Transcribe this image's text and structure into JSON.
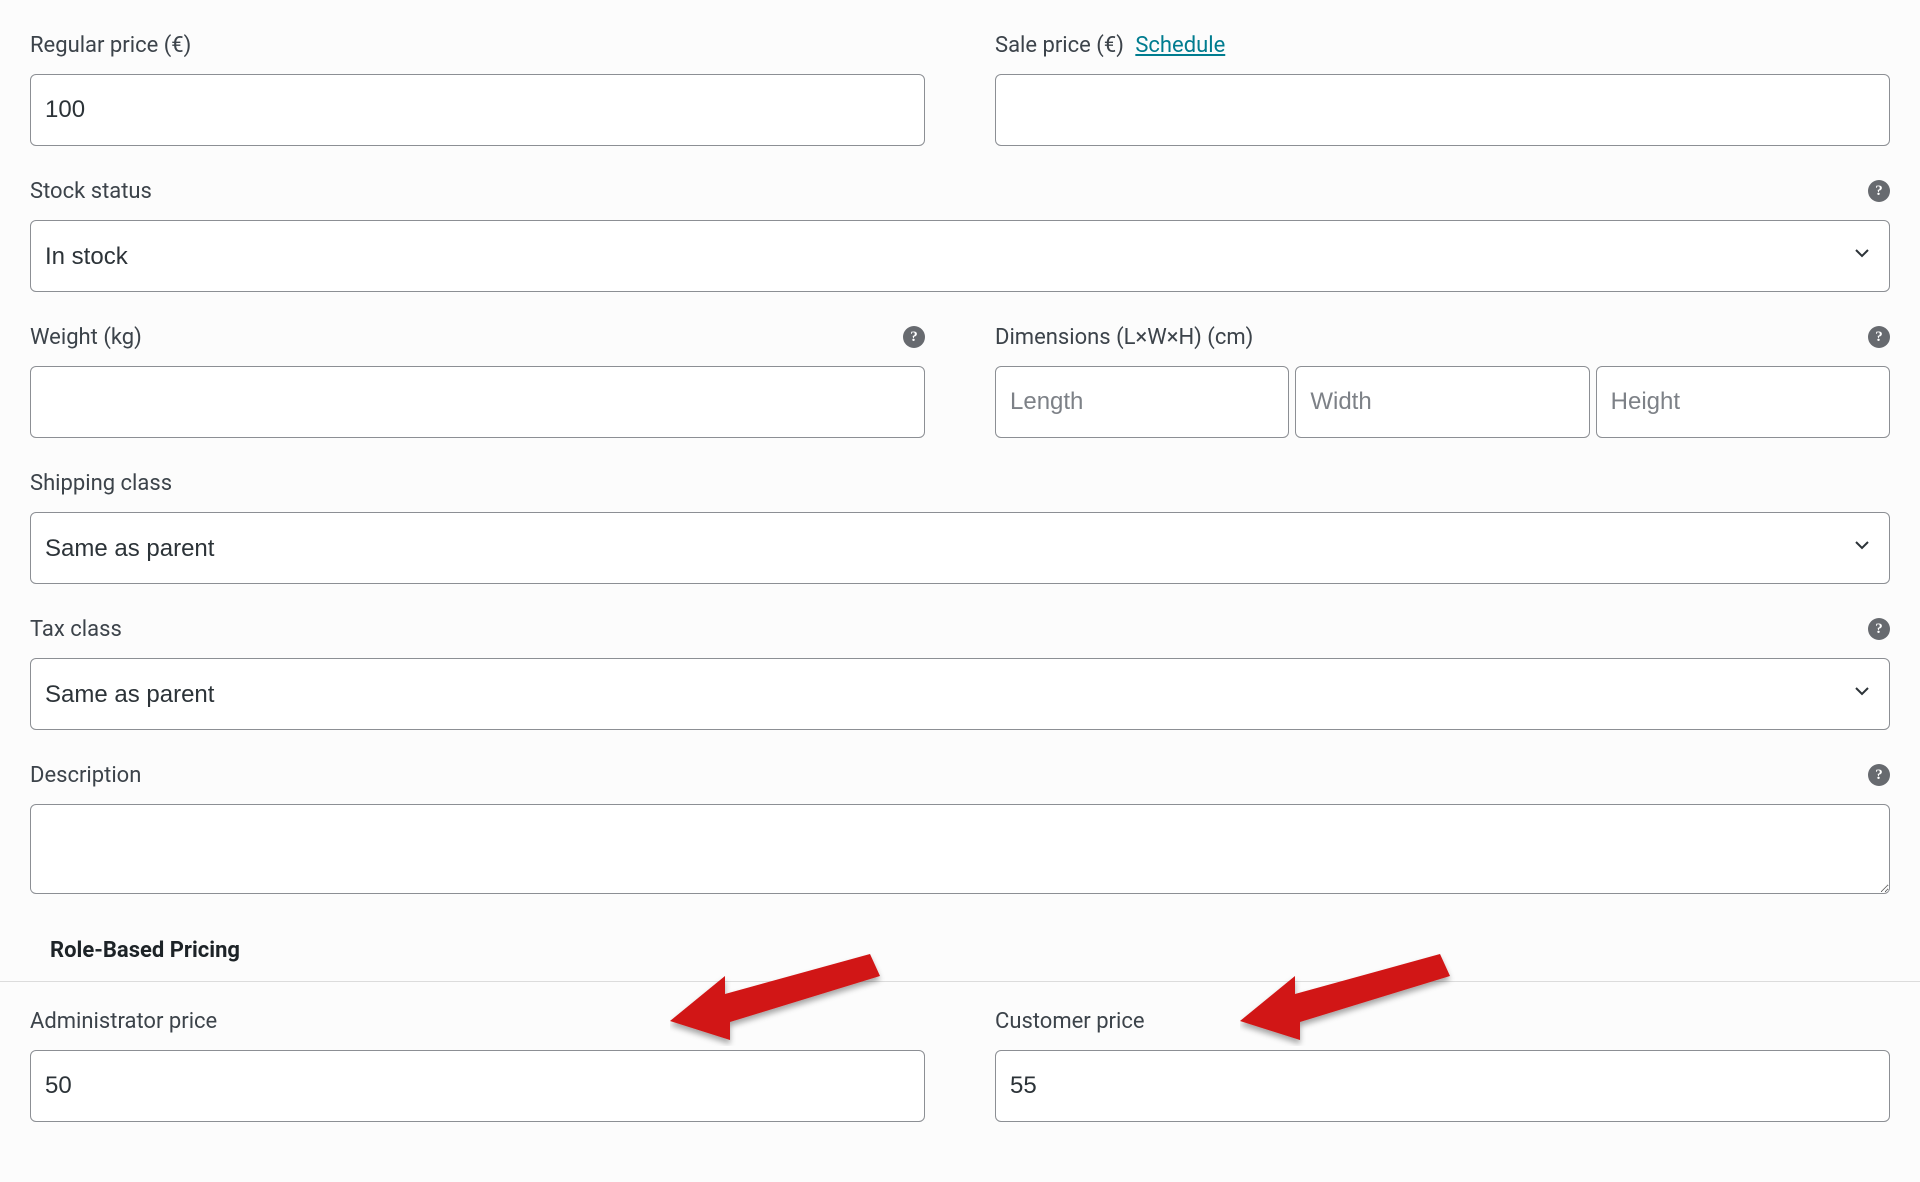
{
  "pricing": {
    "regular_price_label": "Regular price (€)",
    "regular_price_value": "100",
    "sale_price_label": "Sale price (€)",
    "sale_price_value": "",
    "schedule_link": "Schedule"
  },
  "stock": {
    "label": "Stock status",
    "value": "In stock"
  },
  "shipping": {
    "weight_label": "Weight (kg)",
    "weight_value": "",
    "dimensions_label": "Dimensions (L×W×H) (cm)",
    "length_ph": "Length",
    "width_ph": "Width",
    "height_ph": "Height",
    "class_label": "Shipping class",
    "class_value": "Same as parent"
  },
  "tax": {
    "label": "Tax class",
    "value": "Same as parent"
  },
  "description": {
    "label": "Description",
    "value": ""
  },
  "role_pricing": {
    "heading": "Role-Based Pricing",
    "admin_label": "Administrator price",
    "admin_value": "50",
    "customer_label": "Customer price",
    "customer_value": "55"
  },
  "help_glyph": "?"
}
